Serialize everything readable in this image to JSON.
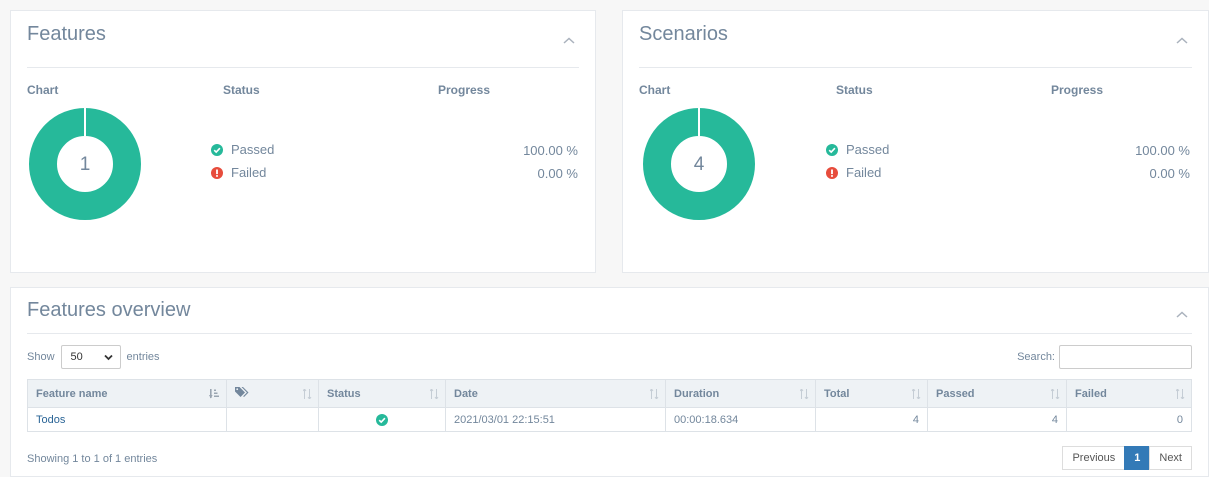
{
  "features_panel": {
    "title": "Features",
    "col_chart": "Chart",
    "col_status": "Status",
    "col_progress": "Progress",
    "donut_count": "1",
    "passed_label": "Passed",
    "failed_label": "Failed",
    "passed_pct": "100.00 %",
    "failed_pct": "0.00 %",
    "passed_fraction": 1.0
  },
  "scenarios_panel": {
    "title": "Scenarios",
    "col_chart": "Chart",
    "col_status": "Status",
    "col_progress": "Progress",
    "donut_count": "4",
    "passed_label": "Passed",
    "failed_label": "Failed",
    "passed_pct": "100.00 %",
    "failed_pct": "0.00 %",
    "passed_fraction": 1.0
  },
  "overview": {
    "title": "Features overview",
    "show_label": "Show",
    "entries_label": "entries",
    "page_size": "50",
    "search_label": "Search:",
    "search_value": "",
    "columns": [
      "Feature name",
      "",
      "Status",
      "Date",
      "Duration",
      "Total",
      "Passed",
      "Failed"
    ],
    "rows": [
      {
        "feature_name": "Todos",
        "tags": "",
        "status": "passed",
        "date": "2021/03/01 22:15:51",
        "duration": "00:00:18.634",
        "total": "4",
        "passed": "4",
        "failed": "0"
      }
    ],
    "info": "Showing 1 to 1 of 1 entries",
    "pager": {
      "previous": "Previous",
      "current": "1",
      "next": "Next"
    }
  },
  "colors": {
    "passed": "#26b99a",
    "failed": "#e74c3c",
    "text": "#73879c",
    "link": "#2a6496",
    "accent": "#337ab7"
  },
  "icons": {
    "collapse": "chevron-up-icon",
    "passed": "check-circle-icon",
    "failed": "exclamation-circle-icon",
    "tags": "tags-icon",
    "sort": "sort-icon"
  }
}
